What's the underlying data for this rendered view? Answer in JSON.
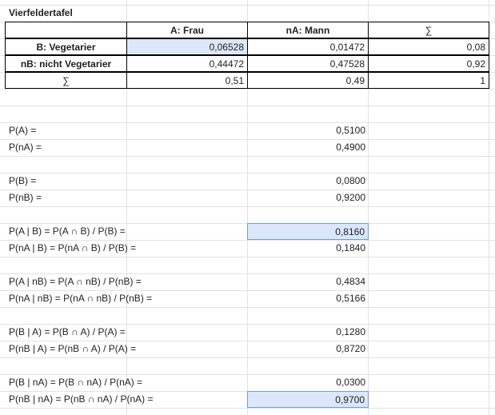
{
  "title": "Vierfeldertafel",
  "table": {
    "headers": [
      "",
      "A: Frau",
      "nA: Mann",
      "∑"
    ],
    "rows": [
      [
        "B: Vegetarier",
        "0,06528",
        "0,01472",
        "0,08"
      ],
      [
        "nB: nicht Vegetarier",
        "0,44472",
        "0,47528",
        "0,92"
      ],
      [
        "∑",
        "0,51",
        "0,49",
        "1"
      ]
    ]
  },
  "probabilities": [
    {
      "label": "P(A) =",
      "value": "0,5100"
    },
    {
      "label": "P(nA) =",
      "value": "0,4900"
    },
    {
      "label": "P(B) =",
      "value": "0,0800"
    },
    {
      "label": "P(nB) =",
      "value": "0,9200"
    },
    {
      "label": "P(A | B) = P(A ∩ B) / P(B) =",
      "value": "0,8160"
    },
    {
      "label": "P(nA | B) = P(nA ∩ B) / P(B) =",
      "value": "0,1840"
    },
    {
      "label": "P(A | nB) = P(A ∩ nB) / P(nB) =",
      "value": "0,4834"
    },
    {
      "label": "P(nA | nB) = P(nA ∩ nB) / P(nB) =",
      "value": "0,5166"
    },
    {
      "label": "P(B | A) = P(B ∩ A) / P(A) =",
      "value": "0,1280"
    },
    {
      "label": "P(nB | A) = P(nB ∩ A) / P(A) =",
      "value": "0,8720"
    },
    {
      "label": "P(B | nA) = P(B ∩ nA) / P(nA) =",
      "value": "0,0300"
    },
    {
      "label": "P(nB | nA) = P(nB ∩ nA) / P(nA) =",
      "value": "0,9700"
    }
  ]
}
